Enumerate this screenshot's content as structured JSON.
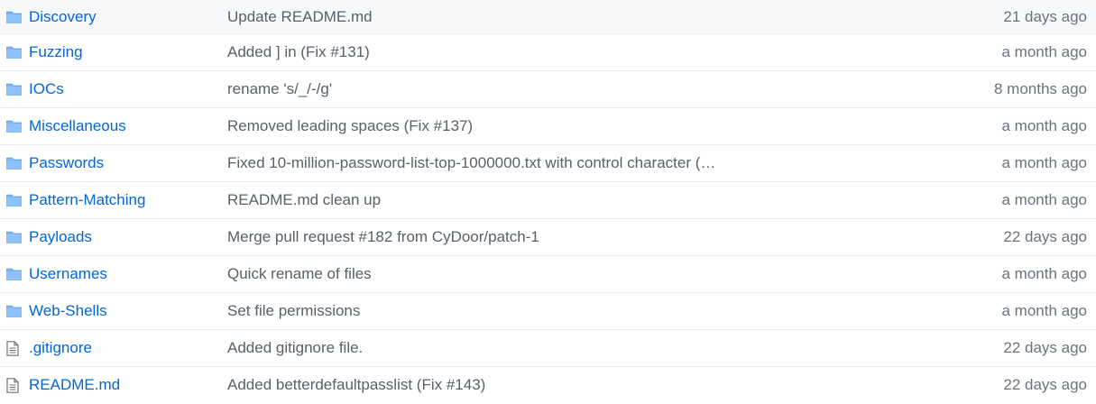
{
  "colors": {
    "link": "#0366d6",
    "message": "#586069",
    "age": "#6a737d",
    "folder_icon": "#79b8ff",
    "file_icon": "#6a737d",
    "row_border": "#eaecef",
    "highlight_row": "#f6f8fa"
  },
  "rows": [
    {
      "type": "folder",
      "icon": "folder-icon",
      "name": "Discovery",
      "message": "Update README.md",
      "age": "21 days ago"
    },
    {
      "type": "folder",
      "icon": "folder-icon",
      "name": "Fuzzing",
      "message": "Added ] in (Fix #131)",
      "age": "a month ago"
    },
    {
      "type": "folder",
      "icon": "folder-icon",
      "name": "IOCs",
      "message": "rename 's/_/-/g'",
      "age": "8 months ago"
    },
    {
      "type": "folder",
      "icon": "folder-icon",
      "name": "Miscellaneous",
      "message": "Removed leading spaces (Fix #137)",
      "age": "a month ago"
    },
    {
      "type": "folder",
      "icon": "folder-icon",
      "name": "Passwords",
      "message": "Fixed 10-million-password-list-top-1000000.txt with control character (…",
      "age": "a month ago"
    },
    {
      "type": "folder",
      "icon": "folder-icon",
      "name": "Pattern-Matching",
      "message": "README.md clean up",
      "age": "a month ago"
    },
    {
      "type": "folder",
      "icon": "folder-icon",
      "name": "Payloads",
      "message": "Merge pull request #182 from CyDoor/patch-1",
      "age": "22 days ago"
    },
    {
      "type": "folder",
      "icon": "folder-icon",
      "name": "Usernames",
      "message": "Quick rename of files",
      "age": "a month ago"
    },
    {
      "type": "folder",
      "icon": "folder-icon",
      "name": "Web-Shells",
      "message": "Set file permissions",
      "age": "a month ago"
    },
    {
      "type": "file",
      "icon": "file-icon",
      "name": ".gitignore",
      "message": "Added gitignore file.",
      "age": "22 days ago"
    },
    {
      "type": "file",
      "icon": "file-icon",
      "name": "README.md",
      "message": "Added betterdefaultpasslist (Fix #143)",
      "age": "22 days ago"
    }
  ]
}
